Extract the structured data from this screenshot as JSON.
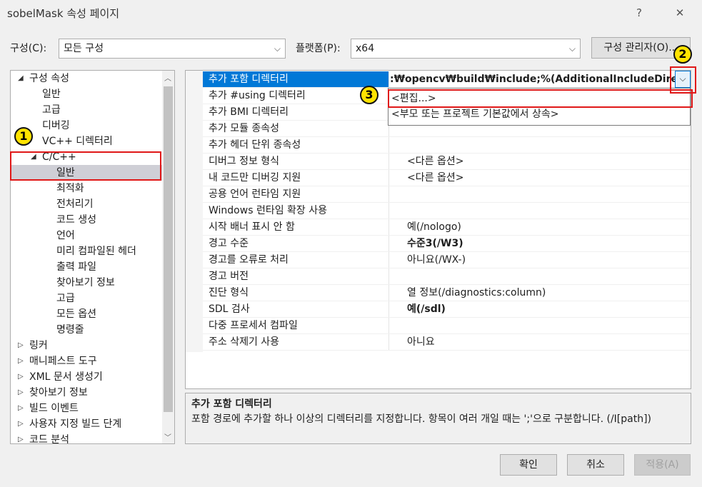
{
  "window": {
    "title": "sobelMask 속성 페이지",
    "help_glyph": "?",
    "close_glyph": "✕"
  },
  "config": {
    "config_label": "구성(C):",
    "config_value": "모든 구성",
    "platform_label": "플랫폼(P):",
    "platform_value": "x64",
    "manager_button": "구성 관리자(O)..."
  },
  "tree": {
    "items": [
      {
        "label": "구성 속성",
        "expander": "◢"
      },
      {
        "label": "일반"
      },
      {
        "label": "고급"
      },
      {
        "label": "디버깅"
      },
      {
        "label": "VC++ 디렉터리"
      },
      {
        "label": "C/C++",
        "expander": "◢"
      },
      {
        "label": "일반"
      },
      {
        "label": "최적화"
      },
      {
        "label": "전처리기"
      },
      {
        "label": "코드 생성"
      },
      {
        "label": "언어"
      },
      {
        "label": "미리 컴파일된 헤더"
      },
      {
        "label": "출력 파일"
      },
      {
        "label": "찾아보기 정보"
      },
      {
        "label": "고급"
      },
      {
        "label": "모든 옵션"
      },
      {
        "label": "명령줄"
      },
      {
        "label": "링커",
        "expander": "▷"
      },
      {
        "label": "매니페스트 도구",
        "expander": "▷"
      },
      {
        "label": "XML 문서 생성기",
        "expander": "▷"
      },
      {
        "label": "찾아보기 정보",
        "expander": "▷"
      },
      {
        "label": "빌드 이벤트",
        "expander": "▷"
      },
      {
        "label": "사용자 지정 빌드 단계",
        "expander": "▷"
      },
      {
        "label": "코드 분석",
        "expander": "▷"
      }
    ]
  },
  "grid": {
    "rows": [
      {
        "name": "추가 포함 디렉터리",
        "value": ":₩opencv₩build₩include;%(AdditionalIncludeDirectories)"
      },
      {
        "name": "추가 #using 디렉터리",
        "value": ""
      },
      {
        "name": "추가 BMI 디렉터리",
        "value": ""
      },
      {
        "name": "추가 모듈 종속성",
        "value": ""
      },
      {
        "name": "추가 헤더 단위 종속성",
        "value": ""
      },
      {
        "name": "디버그 정보 형식",
        "value": "<다른 옵션>"
      },
      {
        "name": "내 코드만 디버깅 지원",
        "value": "<다른 옵션>"
      },
      {
        "name": "공용 언어 런타임 지원",
        "value": ""
      },
      {
        "name": "Windows 런타임 확장 사용",
        "value": ""
      },
      {
        "name": "시작 배너 표시 안 함",
        "value": "예(/nologo)"
      },
      {
        "name": "경고 수준",
        "value": "수준3(/W3)"
      },
      {
        "name": "경고를 오류로 처리",
        "value": "아니요(/WX-)"
      },
      {
        "name": "경고 버전",
        "value": ""
      },
      {
        "name": "진단 형식",
        "value": "열 정보(/diagnostics:column)"
      },
      {
        "name": "SDL 검사",
        "value": "예(/sdl)"
      },
      {
        "name": "다중 프로세서 컴파일",
        "value": ""
      },
      {
        "name": "주소 삭제기 사용",
        "value": "아니요"
      }
    ],
    "dropdown_items": [
      "<편집...>",
      "<부모 또는 프로젝트 기본값에서 상속>"
    ]
  },
  "description": {
    "title": "추가 포함 디렉터리",
    "text": "포함 경로에 추가할 하나 이상의 디렉터리를 지정합니다. 항목이 여러 개일 때는 ';'으로 구분합니다. (/I[path])"
  },
  "buttons": {
    "ok": "확인",
    "cancel": "취소",
    "apply": "적용(A)"
  },
  "annotations": {
    "one": "1",
    "two": "2",
    "three": "3"
  },
  "colors": {
    "accent": "#0078d7",
    "annotation_red": "#e01818",
    "badge_yellow": "#ffe300"
  }
}
